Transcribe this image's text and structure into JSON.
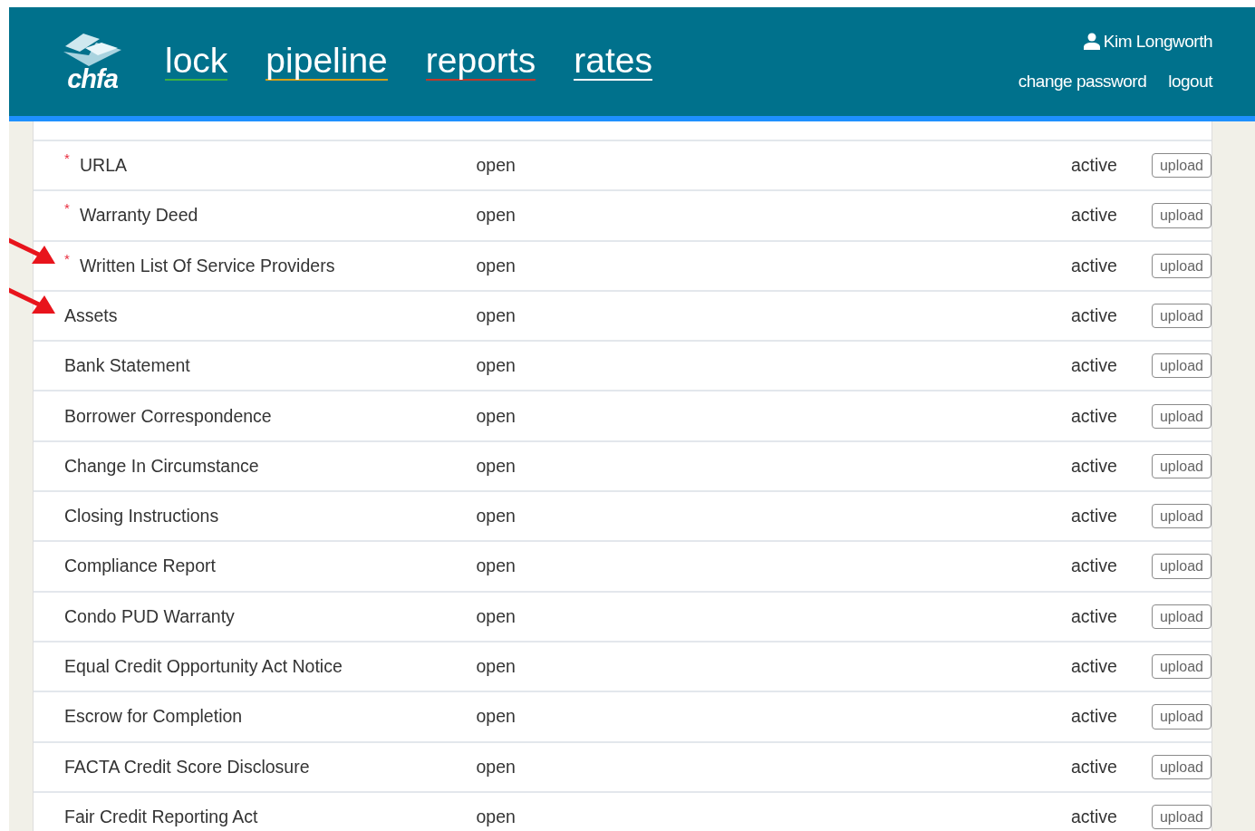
{
  "header": {
    "logo": "chfa",
    "nav": [
      {
        "label": "lock",
        "color": "#3cb043"
      },
      {
        "label": "pipeline",
        "color": "#d4a017"
      },
      {
        "label": "reports",
        "color": "#c0392b"
      },
      {
        "label": "rates",
        "color": "#ffffff"
      }
    ],
    "user": "Kim Longworth",
    "links": [
      "change password",
      "logout"
    ]
  },
  "rows": [
    {
      "name": "URLA",
      "asterisk": "*",
      "arrow": false,
      "condition": "open",
      "status": "active",
      "button": "upload"
    },
    {
      "name": "Warranty Deed",
      "asterisk": "*",
      "arrow": false,
      "condition": "open",
      "status": "active",
      "button": "upload"
    },
    {
      "name": "Written List Of Service Providers",
      "asterisk": "*",
      "arrow": true,
      "condition": "open",
      "status": "active",
      "button": "upload"
    },
    {
      "name": "Assets",
      "arrow": true,
      "condition": "open",
      "status": "active",
      "button": "upload"
    },
    {
      "name": "Bank Statement",
      "arrow": false,
      "condition": "open",
      "status": "active",
      "button": "upload"
    },
    {
      "name": "Borrower Correspondence",
      "arrow": false,
      "condition": "open",
      "status": "active",
      "button": "upload"
    },
    {
      "name": "Change In Circumstance",
      "arrow": false,
      "condition": "open",
      "status": "active",
      "button": "upload"
    },
    {
      "name": "Closing Instructions",
      "arrow": false,
      "condition": "open",
      "status": "active",
      "button": "upload"
    },
    {
      "name": "Compliance Report",
      "arrow": false,
      "condition": "open",
      "status": "active",
      "button": "upload"
    },
    {
      "name": "Condo PUD Warranty",
      "arrow": false,
      "condition": "open",
      "status": "active",
      "button": "upload"
    },
    {
      "name": "Equal Credit Opportunity Act Notice",
      "arrow": false,
      "condition": "open",
      "status": "active",
      "button": "upload"
    },
    {
      "name": "Escrow for Completion",
      "arrow": false,
      "condition": "open",
      "status": "active",
      "button": "upload"
    },
    {
      "name": "FACTA Credit Score Disclosure",
      "arrow": false,
      "condition": "open",
      "status": "active",
      "button": "upload"
    },
    {
      "name": "Fair Credit Reporting Act",
      "arrow": false,
      "condition": "open",
      "status": "active",
      "button": "upload"
    }
  ]
}
